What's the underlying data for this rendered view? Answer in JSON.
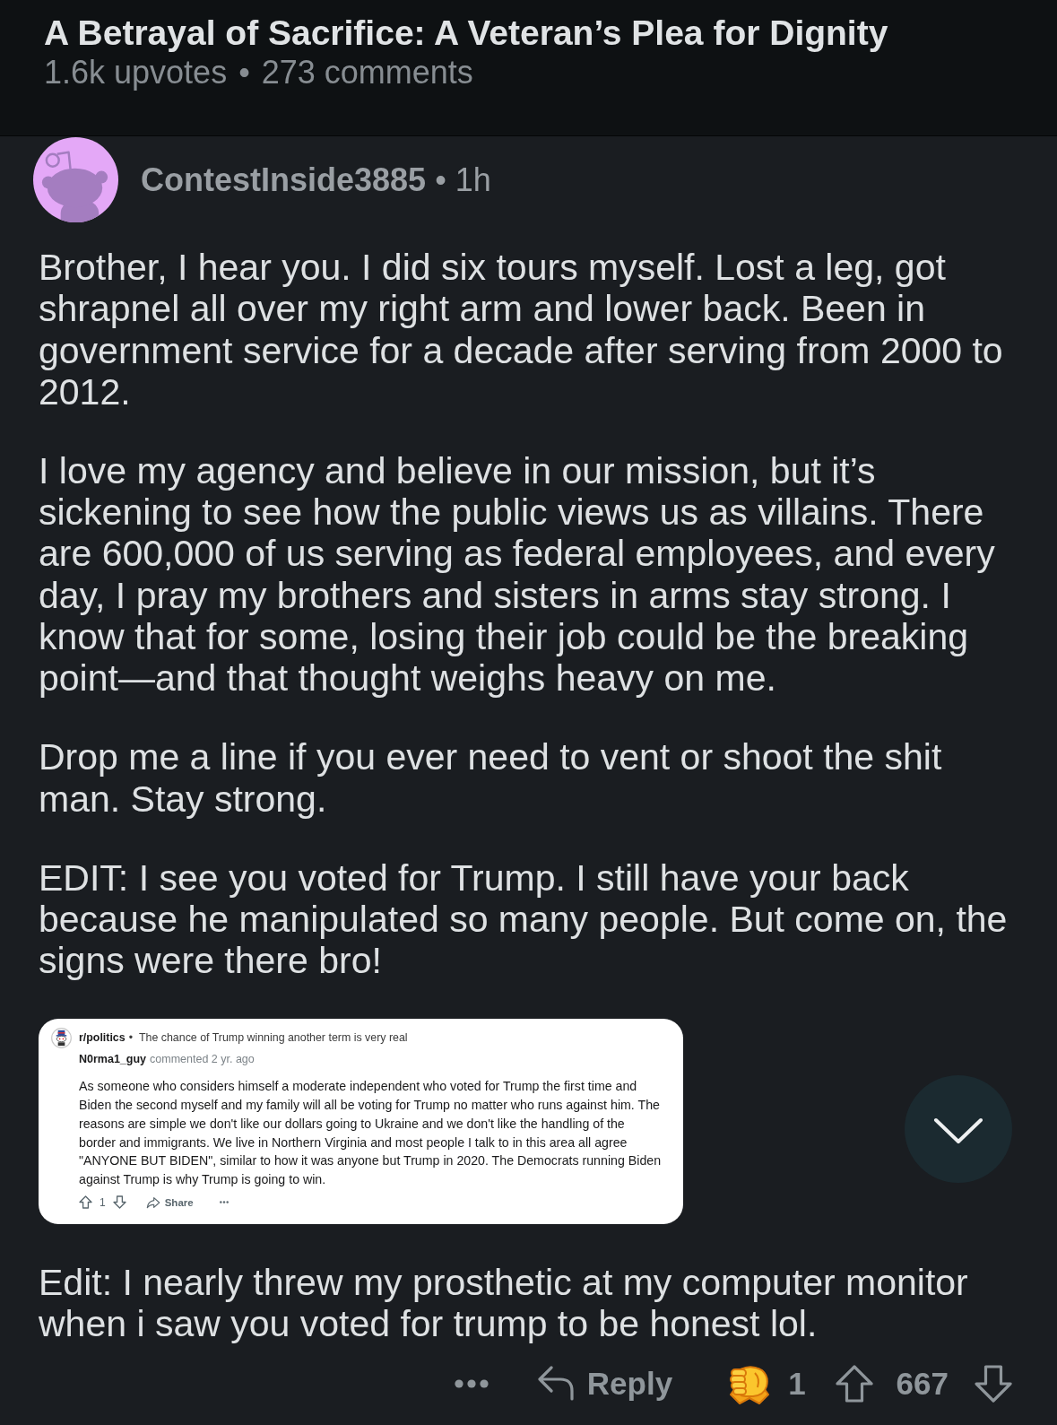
{
  "post": {
    "title": "A Betrayal of Sacrifice: A Veteran’s Plea for Dignity",
    "upvotes": "1.6k upvotes",
    "separator": "•",
    "comments": "273 comments"
  },
  "comment": {
    "author": "ContestInside3885",
    "separator": "•",
    "time": "1h",
    "body": [
      {
        "kind": "text",
        "lines": [
          "Brother, I hear you. I did six tours myself. Lost a leg, got",
          "shrapnel all over my right arm and lower back. Been in",
          "government service for a decade after serving from 2000 to",
          "2012."
        ]
      },
      {
        "kind": "text",
        "lines": [
          "I love my agency and believe in our mission, but it’s",
          "sickening to see how the public views us as villains. There",
          "are 600,000 of us serving as federal employees, and every",
          "day, I pray my brothers and sisters in arms stay strong. I",
          "know that for some, losing their job could be the breaking",
          "point—and that thought weighs heavy on me."
        ]
      },
      {
        "kind": "text",
        "lines": [
          "Drop me a line if you ever need to vent or shoot the shit",
          "man. Stay strong."
        ]
      },
      {
        "kind": "text",
        "lines": [
          "EDIT: I see you voted for Trump. I still have your back",
          "because he manipulated so many people. But come on, the",
          "signs were there bro!"
        ]
      },
      {
        "kind": "screenshot",
        "subreddit": "r/politics",
        "separator": "•",
        "post_title": "The chance of Trump winning another term is very real",
        "author": "N0rma1_guy",
        "meta": "commented 2 yr. ago",
        "lines": [
          "As someone who considers himself a moderate independent who voted for Trump the first time and",
          "Biden the second myself and my family will all be voting for Trump no matter who runs against him. The",
          "reasons are simple we don't like our dollars going to Ukraine and we don't like the handling of the",
          "border and immigrants. We live in Northern Virginia and most people I talk to in this area all agree",
          "\"ANYONE BUT BIDEN\", similar to how it was anyone but Trump in 2020. The Democrats running Biden",
          "against Trump is why Trump is going to win."
        ],
        "score": "1",
        "share": "Share"
      },
      {
        "kind": "text",
        "lines": [
          "Edit: I nearly threw my prosthetic at my computer monitor",
          "when i saw you voted for trump to be honest lol."
        ]
      }
    ],
    "actions": {
      "reply": "Reply",
      "award_count": "1",
      "score": "667"
    }
  }
}
